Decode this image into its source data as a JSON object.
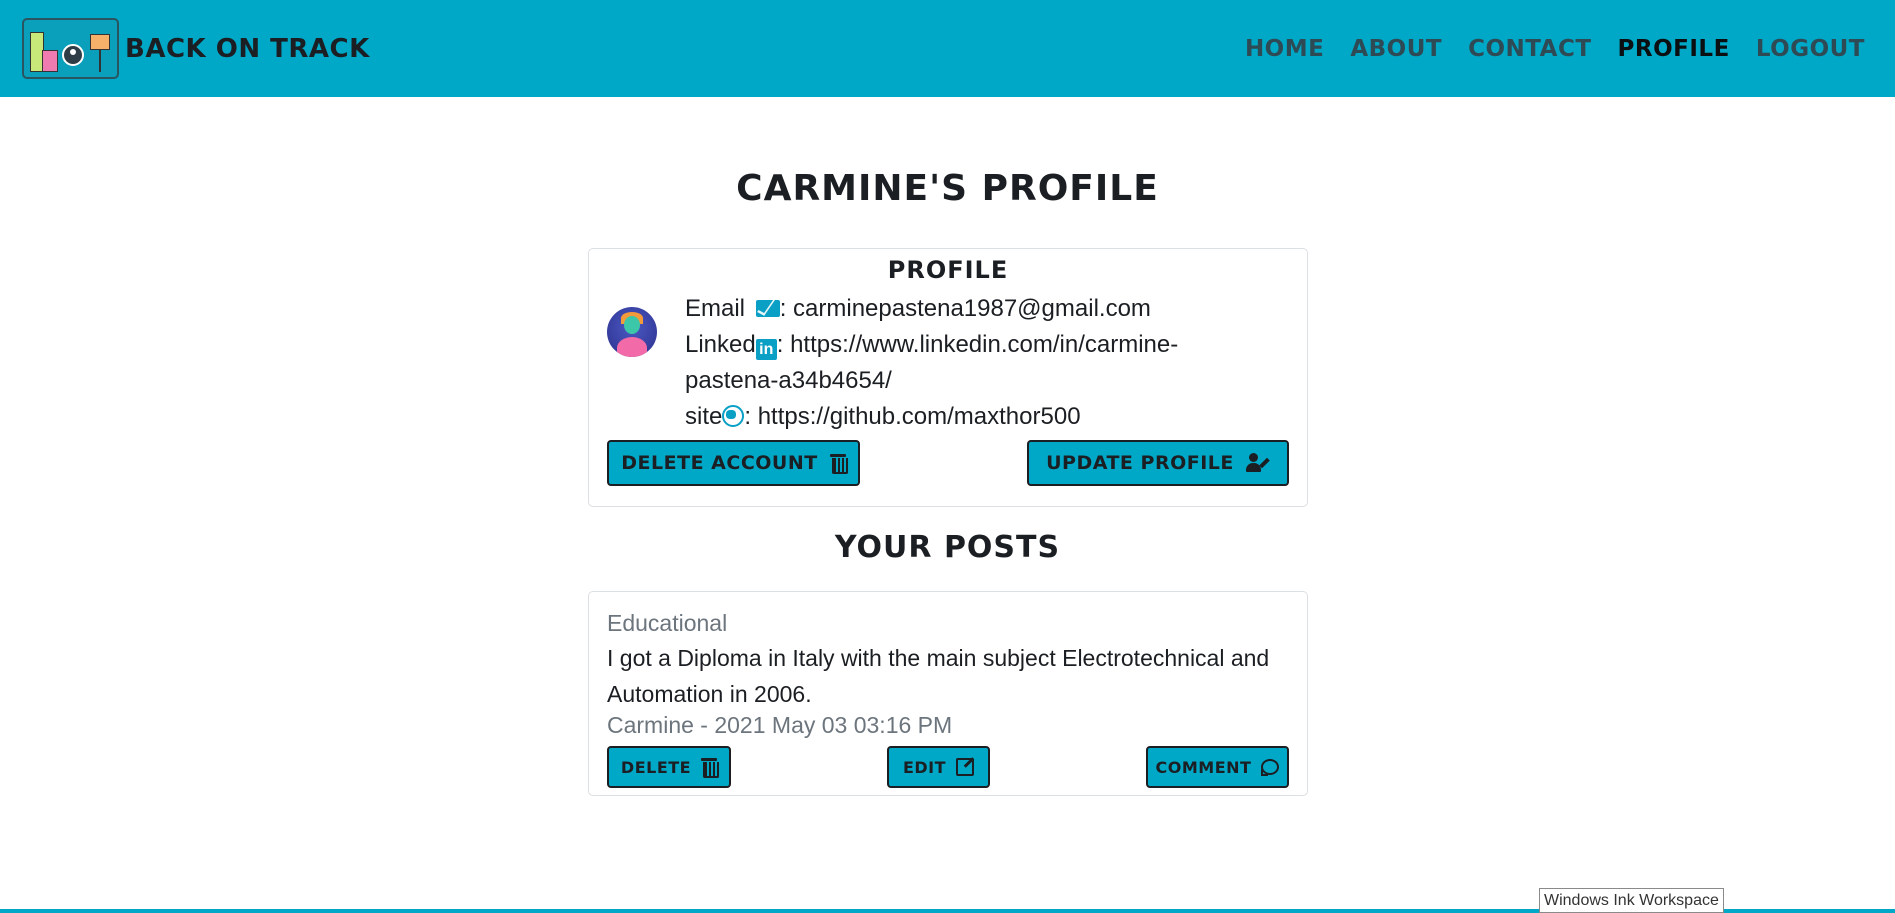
{
  "brand": {
    "name": "Back on Track",
    "logo_icon": "brand-logo"
  },
  "nav": {
    "items": [
      {
        "label": "Home",
        "active": false
      },
      {
        "label": "About",
        "active": false
      },
      {
        "label": "Contact",
        "active": false
      },
      {
        "label": "Profile",
        "active": true
      },
      {
        "label": "Logout",
        "active": false
      }
    ]
  },
  "page": {
    "title": "Carmine's Profile"
  },
  "profile": {
    "heading": "Profile",
    "email_label": "Email",
    "email_value": ": carminepastena1987@gmail.com",
    "linkedin_label": "Linked",
    "linkedin_icon_text": "in",
    "linkedin_value": ": https://www.linkedin.com/in/carmine-pastena-a34b4654/",
    "site_label": "site",
    "site_value": ": https://github.com/maxthor500",
    "delete_button": "Delete Account",
    "update_button": "Update Profile"
  },
  "posts": {
    "heading": "Your Posts",
    "items": [
      {
        "category": "Educational",
        "content": "I got a Diploma in Italy with the main subject Electrotechnical and Automation in 2006.",
        "meta": "Carmine - 2021 May 03 03:16 PM",
        "delete_label": "Delete",
        "edit_label": "Edit",
        "comment_label": "Comment"
      }
    ]
  },
  "system": {
    "tooltip": "Windows Ink Workspace"
  },
  "colors": {
    "accent": "#00a8c8",
    "icon": "#0aa0c5",
    "text": "#1b1e22",
    "muted": "#6c757d"
  }
}
